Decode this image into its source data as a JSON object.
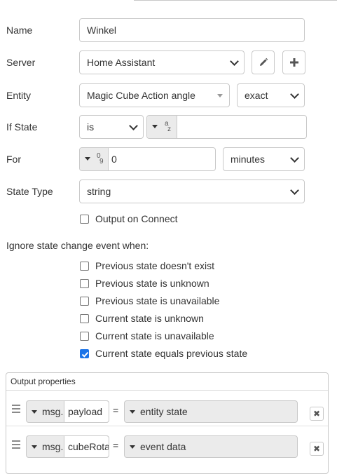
{
  "form": {
    "name_label": "Name",
    "name_value": "Winkel",
    "server_label": "Server",
    "server_value": "Home Assistant",
    "entity_label": "Entity",
    "entity_value": "Magic Cube Action angle",
    "entity_match_value": "exact",
    "if_state_label": "If State",
    "if_state_operator": "is",
    "if_state_type_icon": "az",
    "if_state_value": "",
    "for_label": "For",
    "for_type_icon": "09",
    "for_value": "0",
    "for_unit": "minutes",
    "state_type_label": "State Type",
    "state_type_value": "string",
    "output_on_connect_label": "Output on Connect",
    "output_on_connect_checked": false
  },
  "ignore": {
    "heading": "Ignore state change event when:",
    "options": [
      {
        "label": "Previous state doesn't exist",
        "checked": false
      },
      {
        "label": "Previous state is unknown",
        "checked": false
      },
      {
        "label": "Previous state is unavailable",
        "checked": false
      },
      {
        "label": "Current state is unknown",
        "checked": false
      },
      {
        "label": "Current state is unavailable",
        "checked": false
      },
      {
        "label": "Current state equals previous state",
        "checked": true
      }
    ]
  },
  "output_properties": {
    "title": "Output properties",
    "rows": [
      {
        "prefix": "msg.",
        "property": "payload",
        "equals": "=",
        "value": "entity state"
      },
      {
        "prefix": "msg.",
        "property": "cubeRota",
        "equals": "=",
        "value": "event data"
      }
    ]
  },
  "icons": {
    "edit": "pencil-icon",
    "add": "plus-icon",
    "remove": "close-icon",
    "drag": "drag-handle-icon"
  },
  "colors": {
    "accent": "#1a73e8",
    "border": "#c9c9c9",
    "typed_bg": "#ebebeb"
  }
}
